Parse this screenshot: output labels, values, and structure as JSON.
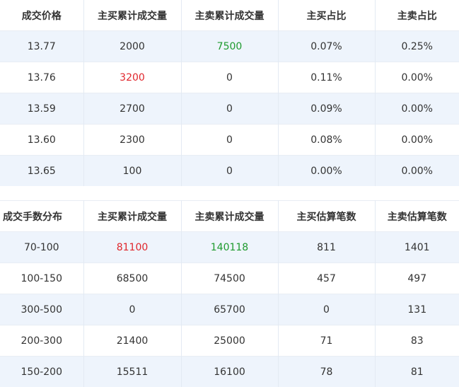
{
  "price_table": {
    "headers": [
      "成交价格",
      "主买累计成交量",
      "主卖累计成交量",
      "主买占比",
      "主卖占比"
    ],
    "rows": [
      [
        "13.77",
        "2000",
        "7500",
        "0.07%",
        "0.25%"
      ],
      [
        "13.76",
        "3200",
        "0",
        "0.11%",
        "0.00%"
      ],
      [
        "13.59",
        "2700",
        "0",
        "0.09%",
        "0.00%"
      ],
      [
        "13.60",
        "2300",
        "0",
        "0.08%",
        "0.00%"
      ],
      [
        "13.65",
        "100",
        "0",
        "0.00%",
        "0.00%"
      ]
    ]
  },
  "lot_table": {
    "headers": [
      "成交手数分布",
      "主买累计成交量",
      "主卖累计成交量",
      "主买估算笔数",
      "主卖估算笔数"
    ],
    "rows": [
      [
        "70-100",
        "81100",
        "140118",
        "811",
        "1401"
      ],
      [
        "100-150",
        "68500",
        "74500",
        "457",
        "497"
      ],
      [
        "300-500",
        "0",
        "65700",
        "0",
        "131"
      ],
      [
        "200-300",
        "21400",
        "25000",
        "71",
        "83"
      ],
      [
        "150-200",
        "15511",
        "16100",
        "78",
        "81"
      ]
    ]
  },
  "colors": {
    "highlight_red": "#e0262c",
    "highlight_green": "#1e9a2e",
    "stripe": "#eef4fc"
  }
}
